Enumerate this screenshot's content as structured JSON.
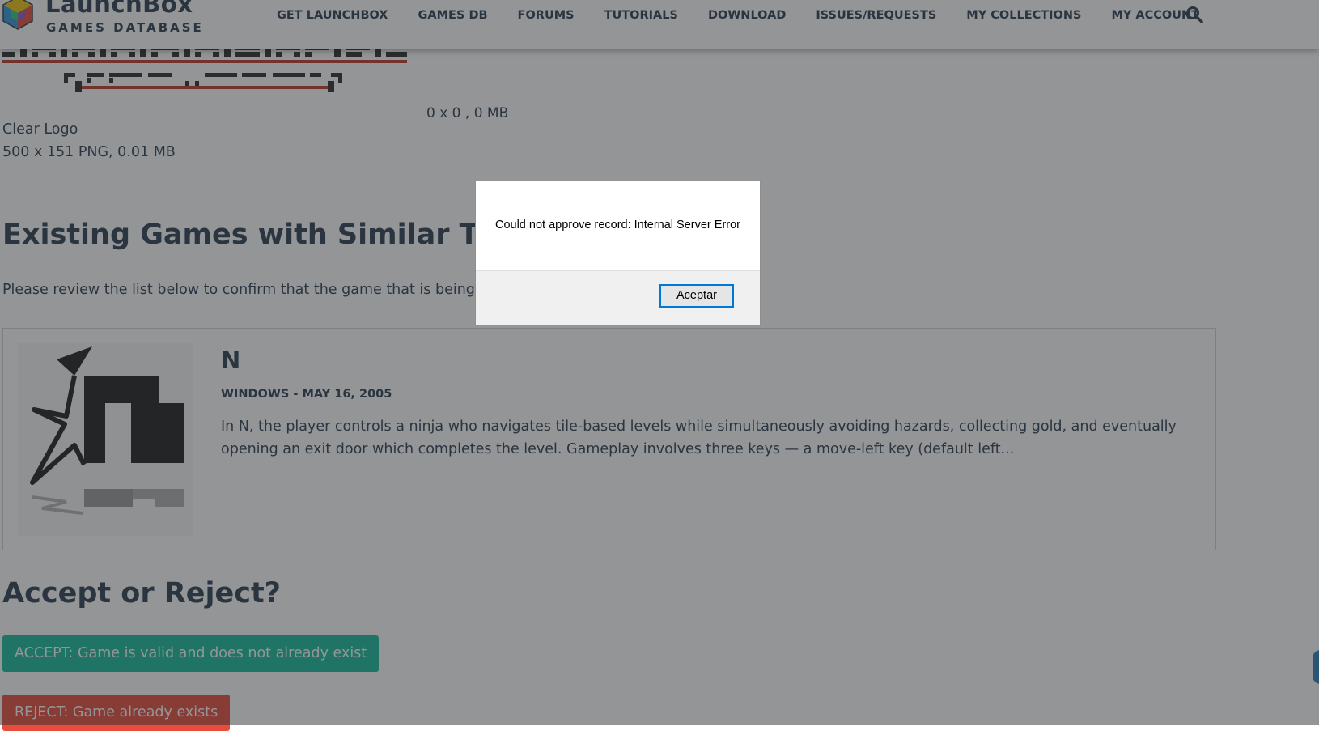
{
  "header": {
    "brand_title": "LaunchBox",
    "brand_subtitle": "GAMES DATABASE",
    "nav": [
      {
        "label": "GET LAUNCHBOX"
      },
      {
        "label": "GAMES DB"
      },
      {
        "label": "FORUMS"
      },
      {
        "label": "TUTORIALS"
      },
      {
        "label": "DOWNLOAD"
      },
      {
        "label": "ISSUES/REQUESTS"
      },
      {
        "label": "MY COLLECTIONS"
      },
      {
        "label": "MY ACCOUNT"
      }
    ],
    "search_icon": "search-icon"
  },
  "images": {
    "second_meta": "0 x 0 , 0 MB",
    "clear_logo_label": "Clear Logo",
    "clear_logo_meta": "500 x 151 PNG, 0.01 MB"
  },
  "similar": {
    "heading": "Existing Games with Similar Titles",
    "review_text": "Please review the list below to confirm that the game that is being added",
    "games": [
      {
        "title": "N",
        "platform_date": "WINDOWS - MAY 16, 2005",
        "description": "In N, the player controls a ninja who navigates tile-based levels while simultaneously avoiding hazards, collecting gold, and eventually opening an exit door which completes the level. Gameplay involves three keys — a move-left key (default left..."
      }
    ]
  },
  "decision": {
    "heading": "Accept or Reject?",
    "accept_label": "ACCEPT: Game is valid and does not already exist",
    "reject_label": "REJECT: Game already exists"
  },
  "dialog": {
    "message": "Could not approve record: Internal Server Error",
    "ok_label": "Aceptar"
  },
  "colors": {
    "accept": "#18bc9c",
    "reject": "#e74c3c",
    "text": "#2c3e50",
    "focus": "#0078d7"
  }
}
